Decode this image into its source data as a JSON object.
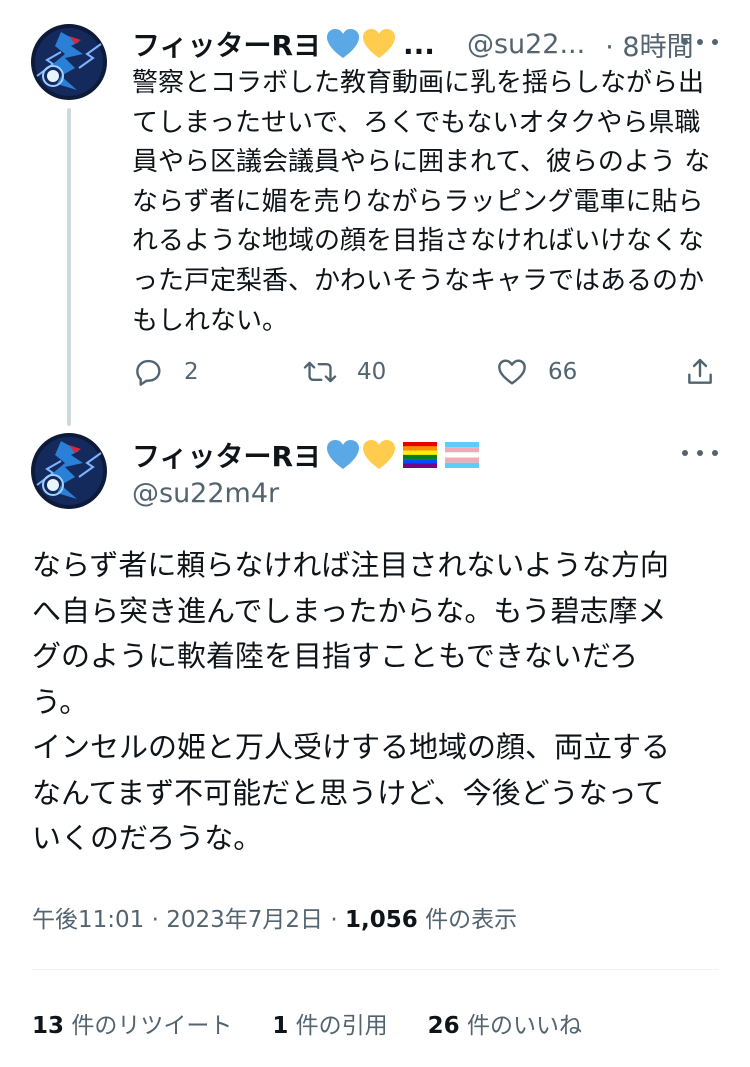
{
  "reply_tweet": {
    "display_name": "フィッターRヨ",
    "name_emojis": [
      "blue-heart",
      "yellow-heart"
    ],
    "name_truncation": "...",
    "handle": "@su22...",
    "time": "· 8時間",
    "text": "警察とコラボした教育動画に乳を揺らしながら出\nてしまったせいで、ろくでもないオタクやら県職\n員やら区議会議員やらに囲まれて、彼らのよう な\nならず者に媚を売りながらラッピング電車に貼ら\nれるような地域の顔を目指さなければいけなくな\nった戸定梨香、かわいそうなキャラではあるのか\nもしれない。",
    "actions": {
      "reply_count": "2",
      "retweet_count": "40",
      "like_count": "66"
    }
  },
  "main_tweet": {
    "display_name": "フィッターRヨ",
    "name_emojis": [
      "blue-heart",
      "yellow-heart",
      "rainbow-flag",
      "transgender-flag"
    ],
    "handle": "@su22m4r",
    "text": "ならず者に頼らなければ注目されないような方向\nへ自ら突き進んでしまったからな。もう碧志摩メ\nグのように軟着陸を目指すこともできないだろ\nう。\nインセルの姫と万人受けする地域の顔、両立する\nなんてまず不可能だと思うけど、今後どうなって\nいくのだろうな。",
    "meta": {
      "time": "午後11:01",
      "date": "2023年7月2日",
      "sep": "·",
      "views_number": "1,056",
      "views_label": "件の表示"
    },
    "stats": {
      "retweets_number": "13",
      "retweets_label": "件のリツイート",
      "quotes_number": "1",
      "quotes_label": "件の引用",
      "likes_number": "26",
      "likes_label": "件のいいね"
    }
  },
  "colors": {
    "text_primary": "#0f1419",
    "text_secondary": "#536471",
    "thread_line": "#cfd9de",
    "divider": "#eff3f4",
    "blue_heart": "#5aa9e6",
    "yellow_heart": "#ffcc4d"
  }
}
